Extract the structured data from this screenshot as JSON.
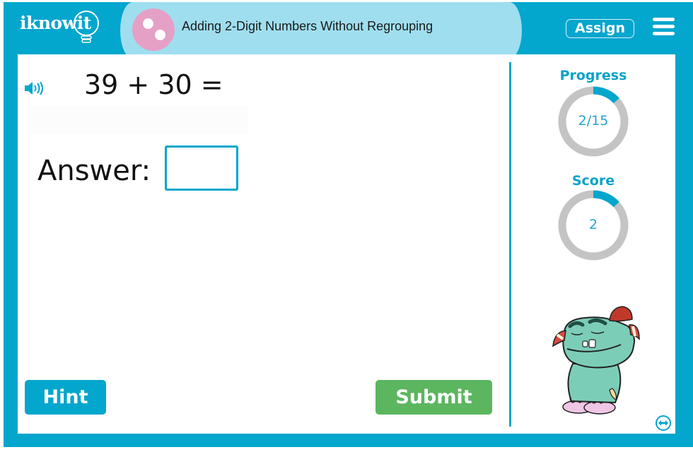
{
  "header": {
    "logo_text": "iknowit",
    "topic_title": "Adding 2-Digit Numbers Without Regrouping",
    "assign_label": "Assign",
    "menu_icon": "hamburger-menu-icon",
    "topic_icon": "two-dots-icon"
  },
  "question": {
    "speaker_icon": "speaker-icon",
    "text": "39 + 30 =",
    "answer_label": "Answer:",
    "answer_value": "",
    "answer_placeholder": ""
  },
  "buttons": {
    "hint": "Hint",
    "submit": "Submit"
  },
  "sidebar": {
    "progress": {
      "title": "Progress",
      "label": "2/15",
      "current": 2,
      "total": 15,
      "fraction": 0.1333
    },
    "score": {
      "title": "Score",
      "label": "2",
      "fraction": 0.1333
    },
    "mascot": "monster-mascot",
    "expand_icon": "expand-horizontal-icon"
  },
  "colors": {
    "brand_teal": "#03a6cd",
    "header_light": "#9fdeef",
    "topic_pink": "#e5a0c6",
    "submit_green": "#5bb65f",
    "ring_track": "#c4c4c4",
    "ring_fill": "#03a6cd"
  }
}
